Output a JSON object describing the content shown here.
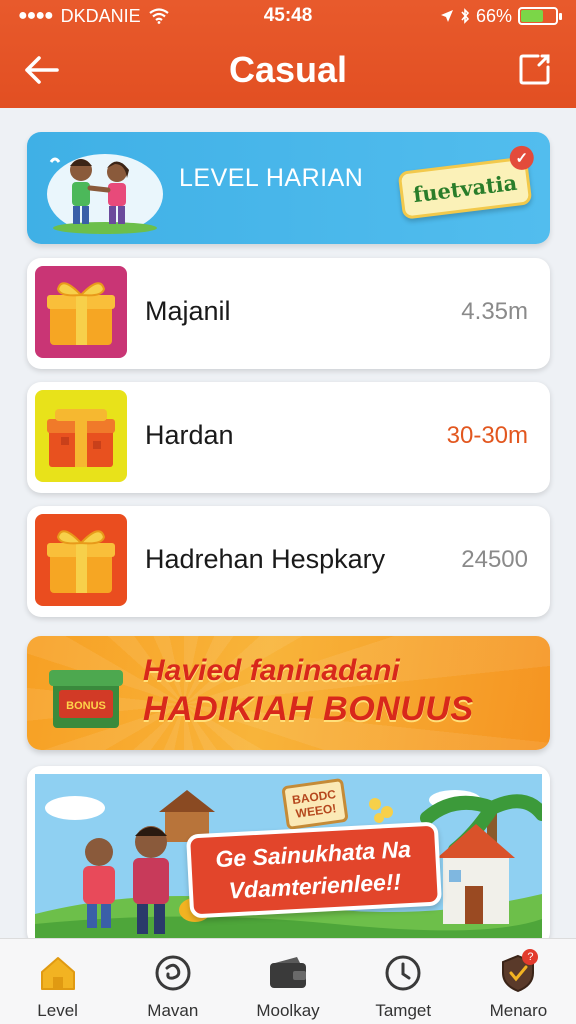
{
  "status_bar": {
    "carrier": "DKDANIE",
    "time": "45:48",
    "battery": "66%"
  },
  "header": {
    "title": "Casual"
  },
  "level_banner": {
    "title": "LEVEL HARIAN",
    "badge": "fuetvatia"
  },
  "rewards": [
    {
      "name": "Majanil",
      "value": "4.35m",
      "value_color": "#8a8a8a",
      "icon_bg": "#c93575"
    },
    {
      "name": "Hardan",
      "value": "30-30m",
      "value_color": "#e2571f",
      "icon_bg": "#e8e21a"
    },
    {
      "name": "Hadrehan Hespkary",
      "value": "24500",
      "value_color": "#8a8a8a",
      "icon_bg": "#ea4d1f"
    }
  ],
  "bonus_banner": {
    "line1": "Havied faninadani",
    "line2": "HADIKIAH BONUUS",
    "box_label": "BONUS"
  },
  "promo_banner": {
    "sign": "BAODC WEEO!",
    "text_line1": "Ge Sainukhata Na",
    "text_line2": "Vdamterienlee!!"
  },
  "bottom_nav": [
    {
      "label": "Level",
      "icon": "home-icon",
      "active": true
    },
    {
      "label": "Mavan",
      "icon": "swirl-icon",
      "active": false
    },
    {
      "label": "Moolkay",
      "icon": "wallet-icon",
      "active": false
    },
    {
      "label": "Tamget",
      "icon": "clock-icon",
      "active": false
    },
    {
      "label": "Menaro",
      "icon": "shield-icon",
      "active": false,
      "badge": "?"
    }
  ],
  "colors": {
    "header": "#e24f22",
    "level_banner": "#3fb0e6",
    "bonus_banner": "#f7a024",
    "bonus_text": "#d8281b",
    "nav_active": "#f2b322"
  }
}
